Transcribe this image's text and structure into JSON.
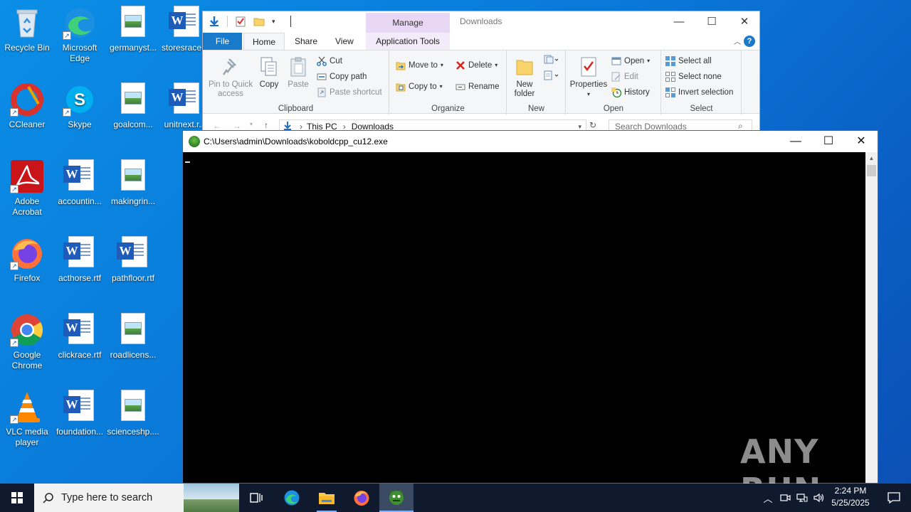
{
  "desktop": {
    "icons": [
      {
        "label": "Recycle Bin"
      },
      {
        "label": "Microsoft Edge"
      },
      {
        "label": "germanyst..."
      },
      {
        "label": "storesrace..."
      },
      {
        "label": "CCleaner"
      },
      {
        "label": "Skype"
      },
      {
        "label": "goalcom..."
      },
      {
        "label": "unitnext.r..."
      },
      {
        "label": "Adobe Acrobat"
      },
      {
        "label": "accountin..."
      },
      {
        "label": "makingrin..."
      },
      {
        "label": "Firefox"
      },
      {
        "label": "acthorse.rtf"
      },
      {
        "label": "pathfloor.rtf"
      },
      {
        "label": "Google Chrome"
      },
      {
        "label": "clickrace.rtf"
      },
      {
        "label": "roadlicens..."
      },
      {
        "label": "VLC media player"
      },
      {
        "label": "foundation..."
      },
      {
        "label": "scienceshp...."
      }
    ]
  },
  "explorer": {
    "title": "Downloads",
    "manage_tab": "Manage",
    "tabs": {
      "file": "File",
      "home": "Home",
      "share": "Share",
      "view": "View",
      "app_tools": "Application Tools"
    },
    "help": "?",
    "clipboard": {
      "label": "Clipboard",
      "pin": "Pin to Quick access",
      "copy": "Copy",
      "paste": "Paste",
      "cut": "Cut",
      "copy_path": "Copy path",
      "paste_shortcut": "Paste shortcut"
    },
    "organize": {
      "label": "Organize",
      "move_to": "Move to",
      "copy_to": "Copy to",
      "delete": "Delete",
      "rename": "Rename"
    },
    "new": {
      "label": "New",
      "new_folder": "New folder"
    },
    "open": {
      "label": "Open",
      "properties": "Properties",
      "open": "Open",
      "edit": "Edit",
      "history": "History"
    },
    "select": {
      "label": "Select",
      "select_all": "Select all",
      "select_none": "Select none",
      "invert": "Invert selection"
    },
    "address": {
      "crumb1": "This PC",
      "crumb2": "Downloads",
      "search_placeholder": "Search Downloads"
    }
  },
  "console": {
    "title": "C:\\Users\\admin\\Downloads\\koboldcpp_cu12.exe"
  },
  "watermark": "ANY RUN",
  "taskbar": {
    "search_placeholder": "Type here to search",
    "time": "2:24 PM",
    "date": "5/25/2025"
  },
  "colors": {
    "file_tab": "#1979ca",
    "manage_tab": "#e9d8f5",
    "taskbar": "#0f1a2e",
    "desktop": "#0a78d8"
  }
}
